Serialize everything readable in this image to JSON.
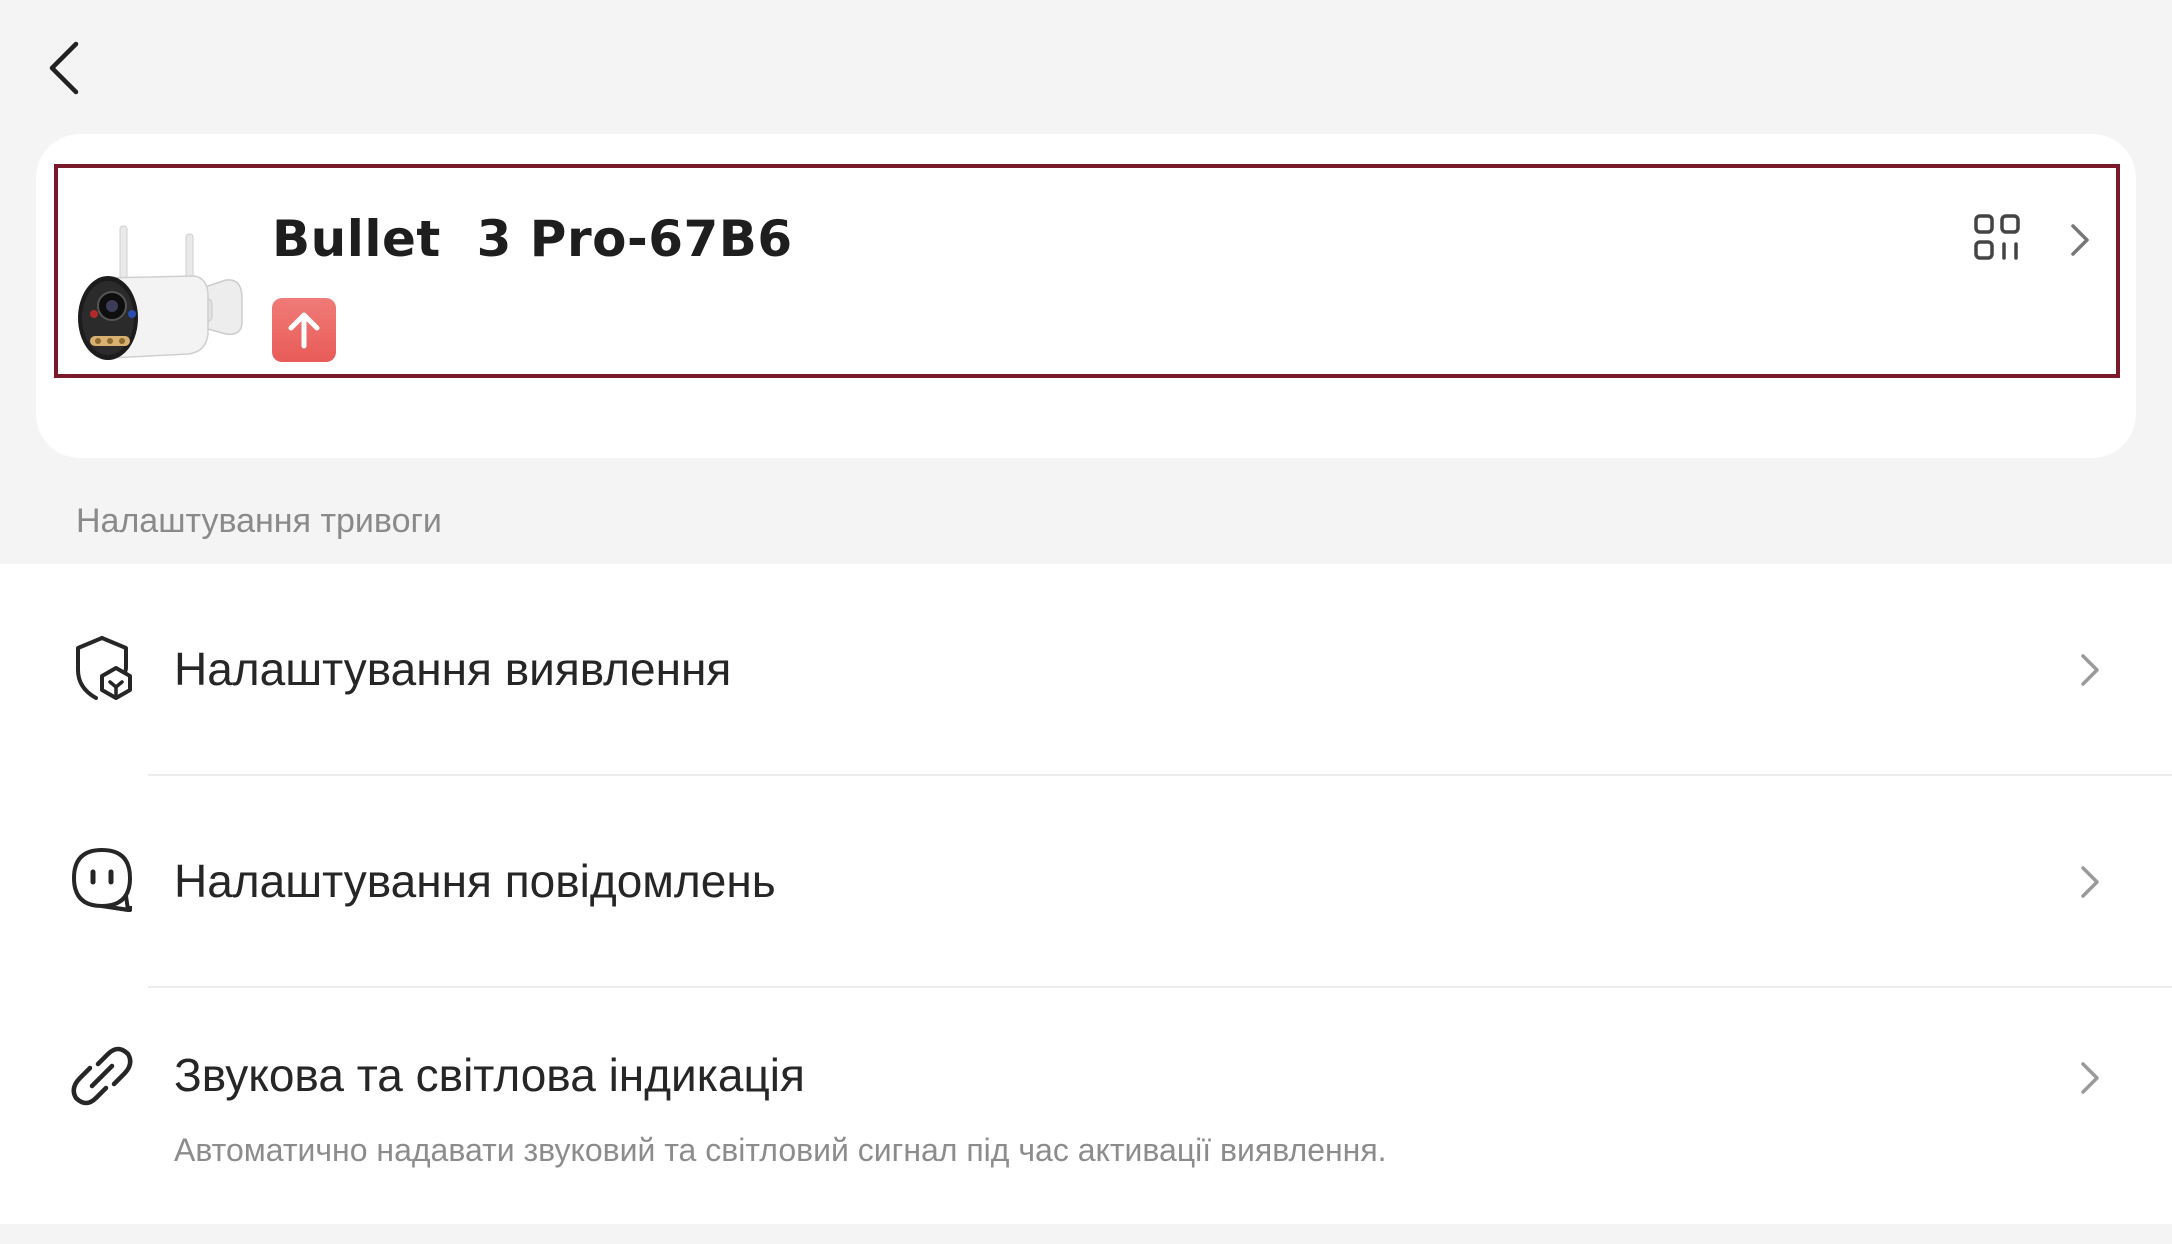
{
  "header": {
    "back_icon": "chevron-left-icon"
  },
  "device": {
    "name": "Bullet  3 Pro-67B6",
    "thumbnail": "camera-thumbnail",
    "update_icon": "arrow-up-icon",
    "qr_icon": "qr-code-icon",
    "chevron_icon": "chevron-right-icon",
    "highlight_color": "#7a1a2a",
    "update_badge_color": "#e85b58"
  },
  "section": {
    "label": "Налаштування тривоги"
  },
  "settings": {
    "items": [
      {
        "label": "Налаштування виявлення",
        "icon": "shield-detection-icon"
      },
      {
        "label": "Налаштування повідомлень",
        "icon": "message-bubble-icon"
      },
      {
        "label": "Звукова та світлова індикація",
        "icon": "link-icon",
        "description": "Автоматично надавати звуковий та світловий сигнал під час активації виявлення."
      }
    ]
  }
}
